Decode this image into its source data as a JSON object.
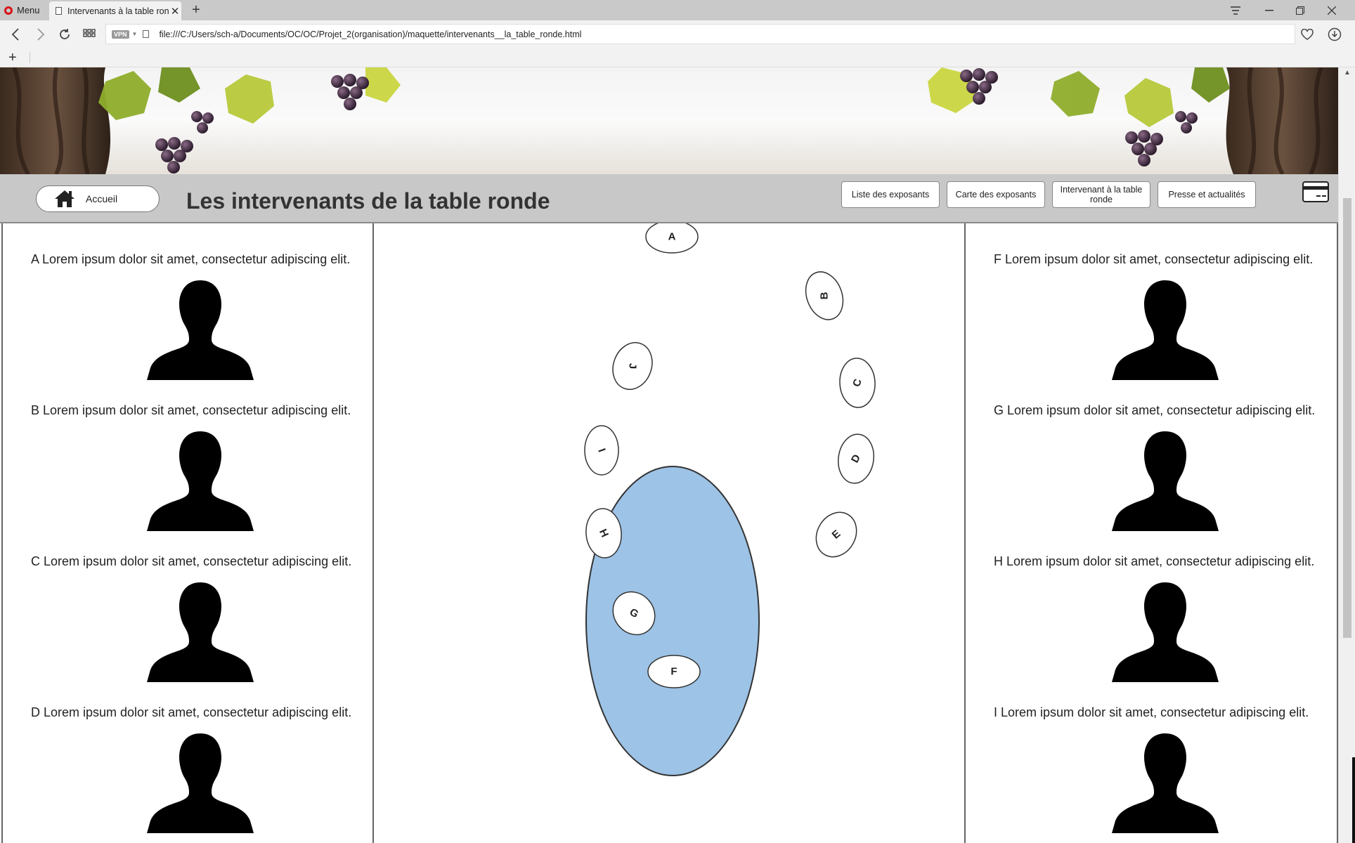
{
  "browser": {
    "menu_label": "Menu",
    "tab_title": "Intervenants à la table ronde",
    "url": "file:///C:/Users/sch-a/Documents/OC/OC/Projet_2(organisation)/maquette/intervenants__la_table_ronde.html",
    "vpn_label": "VPN"
  },
  "header": {
    "home_label": "Accueil",
    "title": "Les intervenants de la table ronde",
    "nav": [
      {
        "label": "Liste des exposants"
      },
      {
        "label": "Carte des exposants"
      },
      {
        "label": "Intervenant à la table ronde"
      },
      {
        "label": "Presse et actualités"
      }
    ]
  },
  "speakers_left": [
    {
      "text": "A Lorem ipsum dolor sit amet, consectetur adipiscing elit."
    },
    {
      "text": "B Lorem ipsum dolor sit amet, consectetur adipiscing elit."
    },
    {
      "text": "C Lorem ipsum dolor sit amet, consectetur adipiscing elit."
    },
    {
      "text": "D Lorem ipsum dolor sit amet, consectetur adipiscing elit."
    }
  ],
  "speakers_right": [
    {
      "text": "F Lorem ipsum dolor sit amet, consectetur adipiscing elit."
    },
    {
      "text": "G Lorem ipsum dolor sit amet, consectetur adipiscing elit."
    },
    {
      "text": "H Lorem ipsum dolor sit amet, consectetur adipiscing elit."
    },
    {
      "text": "I Lorem ipsum dolor sit amet, consectetur adipiscing elit."
    }
  ],
  "table": {
    "table_color": "#9dc3e6",
    "seats": [
      "A",
      "B",
      "C",
      "D",
      "E",
      "F",
      "G",
      "H",
      "I",
      "J"
    ]
  },
  "colors": {
    "header_bg": "#c8c8c8",
    "divider": "#666666"
  }
}
